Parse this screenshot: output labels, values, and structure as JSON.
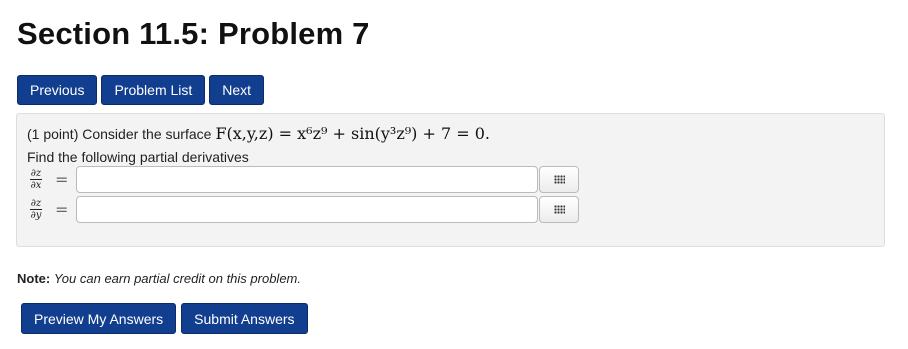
{
  "page": {
    "title": "Section 11.5: Problem 7"
  },
  "nav": {
    "previous_label": "Previous",
    "problem_list_label": "Problem List",
    "next_label": "Next"
  },
  "problem": {
    "statement_prefix": "(1 point) Consider the surface",
    "equation": "F(x,y,z) = x⁶z⁹ + sin(y³z⁹) + 7 = 0.",
    "instruction": "Find the following partial derivatives",
    "answers": [
      {
        "numerator": "∂z",
        "denominator": "∂x",
        "value": "",
        "placeholder": ""
      },
      {
        "numerator": "∂z",
        "denominator": "∂y",
        "value": "",
        "placeholder": ""
      }
    ],
    "palette_icon": "grid-icon"
  },
  "note": {
    "label": "Note:",
    "text": "You can earn partial credit on this problem."
  },
  "actions": {
    "preview_label": "Preview My Answers",
    "submit_label": "Submit Answers"
  },
  "colors": {
    "button_bg": "#123e8f",
    "panel_bg": "#f3f3f3"
  }
}
